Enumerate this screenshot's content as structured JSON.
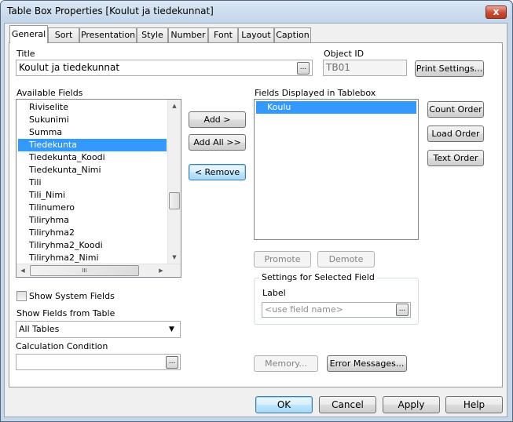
{
  "window": {
    "title": "Table Box Properties [Koulut ja tiedekunnat]",
    "close_glyph": "x"
  },
  "tabs": [
    {
      "label": "General",
      "active": true
    },
    {
      "label": "Sort"
    },
    {
      "label": "Presentation"
    },
    {
      "label": "Style"
    },
    {
      "label": "Number"
    },
    {
      "label": "Font"
    },
    {
      "label": "Layout"
    },
    {
      "label": "Caption"
    }
  ],
  "general": {
    "title_label": "Title",
    "title_value": "Koulut ja tiedekunnat",
    "object_id_label": "Object ID",
    "object_id_value": "TB01",
    "print_settings": "Print Settings...",
    "available_fields_label": "Available Fields",
    "available_fields": [
      "Riviselite",
      "Sukunimi",
      "Summa",
      "Tiedekunta",
      "Tiedekunta_Koodi",
      "Tiedekunta_Nimi",
      "Tili",
      "Tili_Nimi",
      "Tilinumero",
      "Tiliryhma",
      "Tiliryhma2",
      "Tiliryhma2_Koodi",
      "Tiliryhma2_Nimi"
    ],
    "selected_available": "Tiedekunta",
    "add_button": "Add >",
    "add_all_button": "Add All >>",
    "remove_button": "< Remove",
    "displayed_label": "Fields Displayed in Tablebox",
    "displayed_fields": [
      "Koulu"
    ],
    "count_order": "Count Order",
    "load_order": "Load Order",
    "text_order": "Text Order",
    "promote": "Promote",
    "demote": "Demote",
    "settings_group": "Settings for Selected Field",
    "label_label": "Label",
    "label_placeholder": "<use field name>",
    "show_system_fields": "Show System Fields",
    "show_system_fields_checked": false,
    "show_fields_from_label": "Show Fields from Table",
    "show_fields_from_value": "All Tables",
    "calc_condition_label": "Calculation Condition",
    "calc_condition_value": "",
    "memory": "Memory...",
    "error_messages": "Error Messages...",
    "ellipsis": "...",
    "hscroll_grip": "III"
  },
  "footer": {
    "ok": "OK",
    "cancel": "Cancel",
    "apply": "Apply",
    "help": "Help"
  },
  "colors": {
    "selection": "#3399ff",
    "frame": "#c5d6e8",
    "close": "#c94b33"
  }
}
